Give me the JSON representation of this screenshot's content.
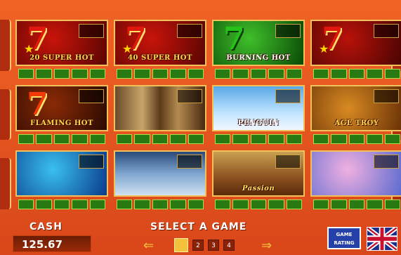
{
  "games": [
    {
      "name": "20 SUPER HOT"
    },
    {
      "name": "40 SUPER HOT"
    },
    {
      "name": "BURNING HOT"
    },
    {
      "name": ""
    },
    {
      "name": "FLAMING HOT"
    },
    {
      "name": ""
    },
    {
      "name": "PENGUIN"
    },
    {
      "name": "AGE TROY"
    },
    {
      "name": ""
    },
    {
      "name": ""
    },
    {
      "name": "Passion"
    },
    {
      "name": ""
    }
  ],
  "footer": {
    "cash_label": "CASH",
    "cash_value": "125.67",
    "select_label": "SELECT A GAME",
    "pages": [
      "1",
      "2",
      "3",
      "4"
    ],
    "active_page": "1",
    "rating_line1": "GAME",
    "rating_line2": "RATING"
  },
  "icons": {
    "prev": "arrow-left-icon",
    "next": "arrow-right-icon",
    "language": "uk-flag-icon"
  }
}
